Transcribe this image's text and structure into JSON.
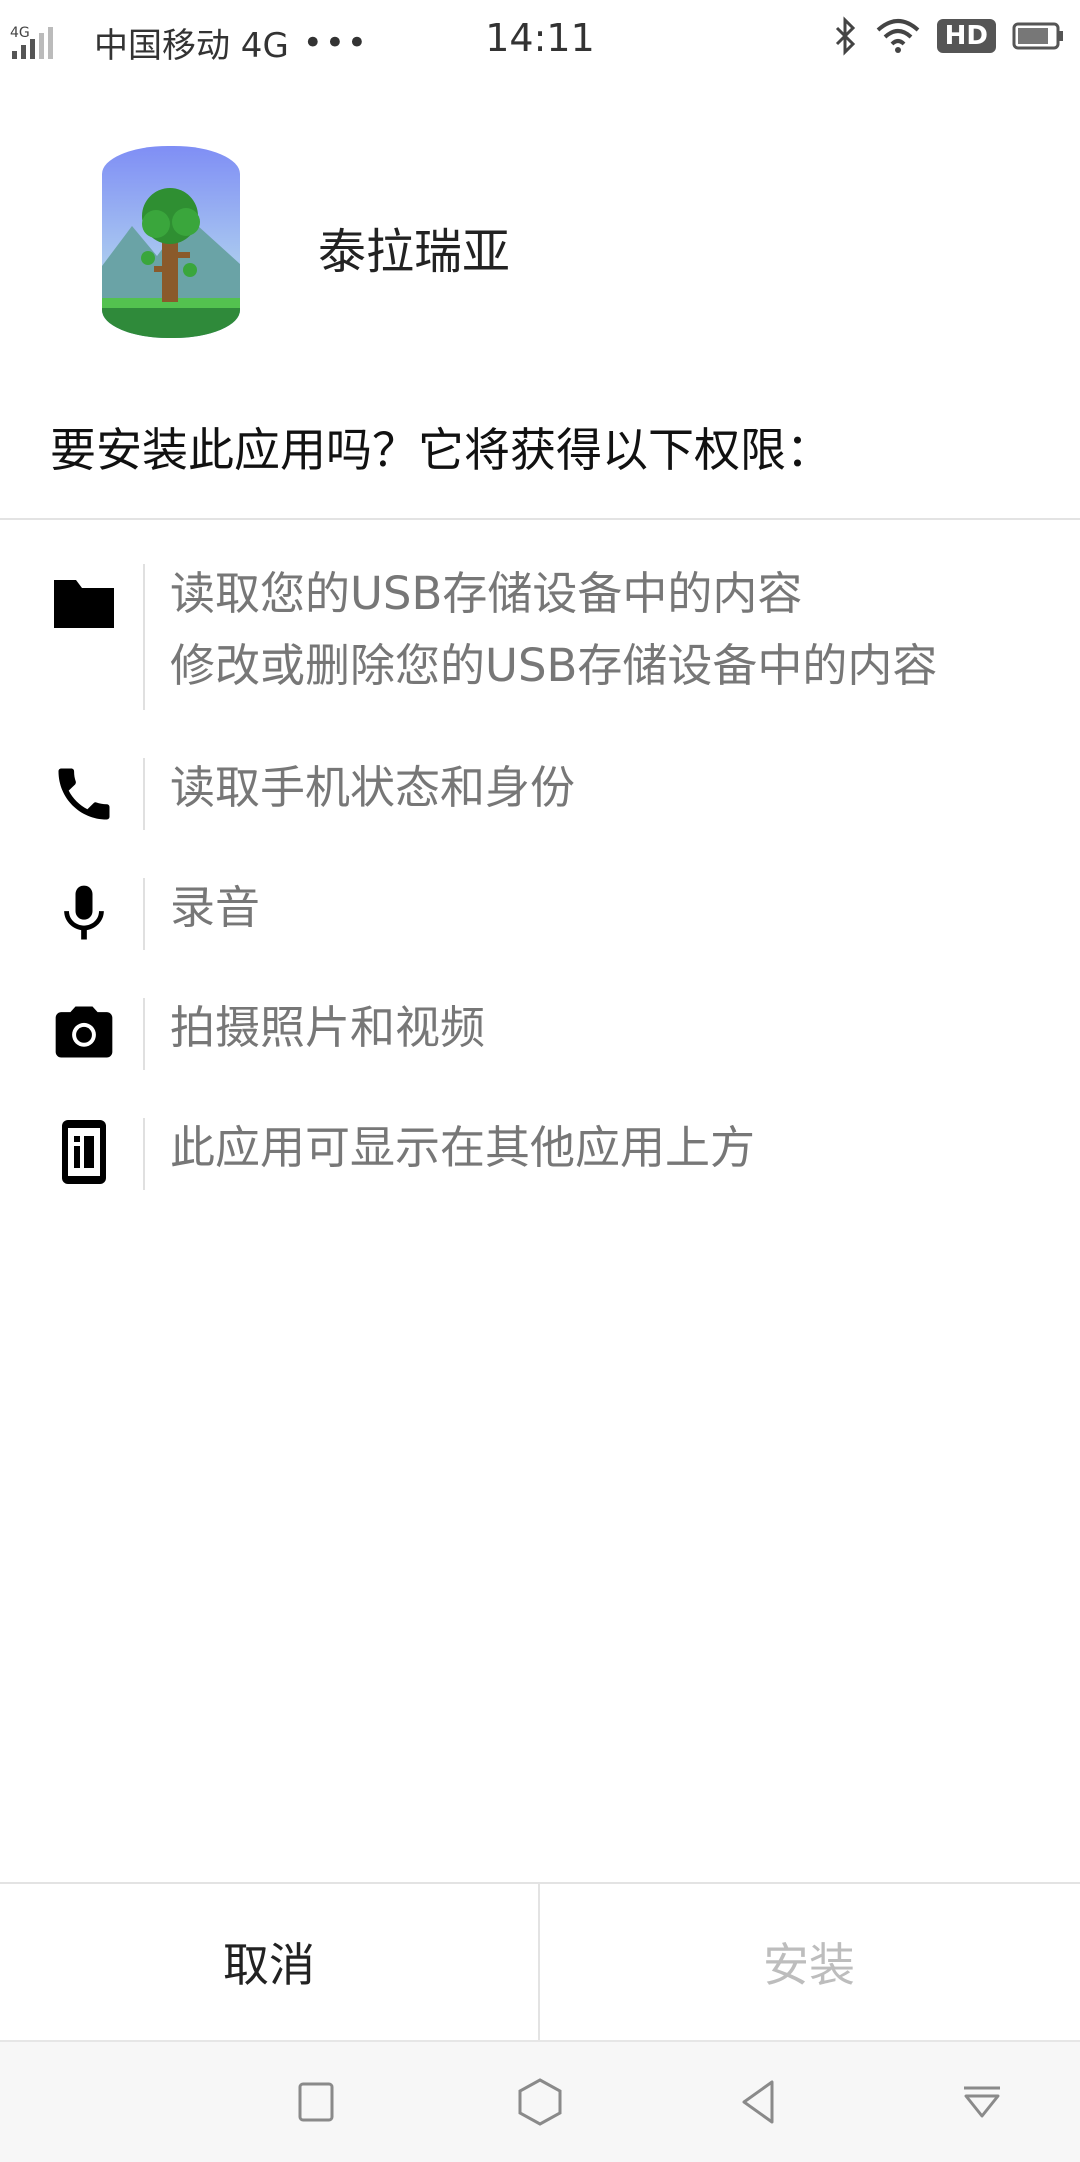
{
  "status_bar": {
    "carrier": "中国移动 4G",
    "network_small": "4G",
    "more": "•••",
    "time": "14:11",
    "hd": "HD"
  },
  "app": {
    "name": "泰拉瑞亚",
    "icon": "terraria-tree-icon"
  },
  "prompt": "要安装此应用吗？它将获得以下权限：",
  "permissions": [
    {
      "icon": "folder-icon",
      "lines": [
        "读取您的USB存储设备中的内容",
        "修改或删除您的USB存储设备中的内容"
      ]
    },
    {
      "icon": "phone-icon",
      "lines": [
        "读取手机状态和身份"
      ]
    },
    {
      "icon": "microphone-icon",
      "lines": [
        "录音"
      ]
    },
    {
      "icon": "camera-icon",
      "lines": [
        "拍摄照片和视频"
      ]
    },
    {
      "icon": "overlay-icon",
      "lines": [
        "此应用可显示在其他应用上方"
      ]
    }
  ],
  "buttons": {
    "cancel": "取消",
    "install": "安装"
  },
  "colors": {
    "text_primary": "#222222",
    "text_secondary": "#777777",
    "install_disabled": "#bdbdbd",
    "divider": "#e3e3e3"
  }
}
